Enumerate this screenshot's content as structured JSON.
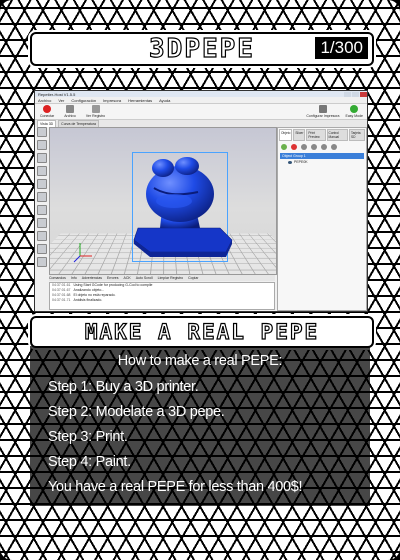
{
  "card": {
    "title": "3DPEPE",
    "counter": "1/300",
    "subtitle": "MAKE A REAL PEPE",
    "description_heading": "How to make a real PEPE:",
    "description_lines": [
      "Step 1: Buy a 3D printer.",
      "Step 2: Modelate a 3D pepe.",
      "Step 3: Print.",
      "Step 4: Paint.",
      "You have a real PEPE for less than 400$!"
    ]
  },
  "screenshot": {
    "window_title": "Repetier-Host V1.5.5",
    "menu": [
      "Archivo",
      "Ver",
      "Configuración",
      "Impresora",
      "Herramientas",
      "Ayuda"
    ],
    "toolbar": [
      "Conectar",
      "Archivo",
      "Ver Registro"
    ],
    "toolbar_right": [
      "Configurar Impresora",
      "Easy Mode"
    ],
    "tabs": [
      "Vista 3D",
      "Curva de Temperatura"
    ],
    "right_tabs": [
      "Objeto",
      "Slicer",
      "Print Preview",
      "Control Manual",
      "Tarjeta SD"
    ],
    "object_group": "Object Group 1",
    "object_item": "PEPE0K",
    "status_items": [
      "Comandos",
      "Info",
      "Advertencias",
      "Errores",
      "ACK",
      "Auto Scroll",
      "Limpiar Registro",
      "Copiar"
    ],
    "log": [
      {
        "time": "04:37:01.61",
        "text": "Using Start GCode for producing G-Cod to compile"
      },
      {
        "time": "04:37:01.67",
        "text": "Analizando objeto..."
      },
      {
        "time": "04:37:01.68",
        "text": "El objeto no está reparado."
      },
      {
        "time": "04:37:01.71",
        "text": "Análisis finalizado."
      }
    ]
  },
  "colors": {
    "model": "#1f4be6",
    "bbox": "#4aa3ff"
  }
}
